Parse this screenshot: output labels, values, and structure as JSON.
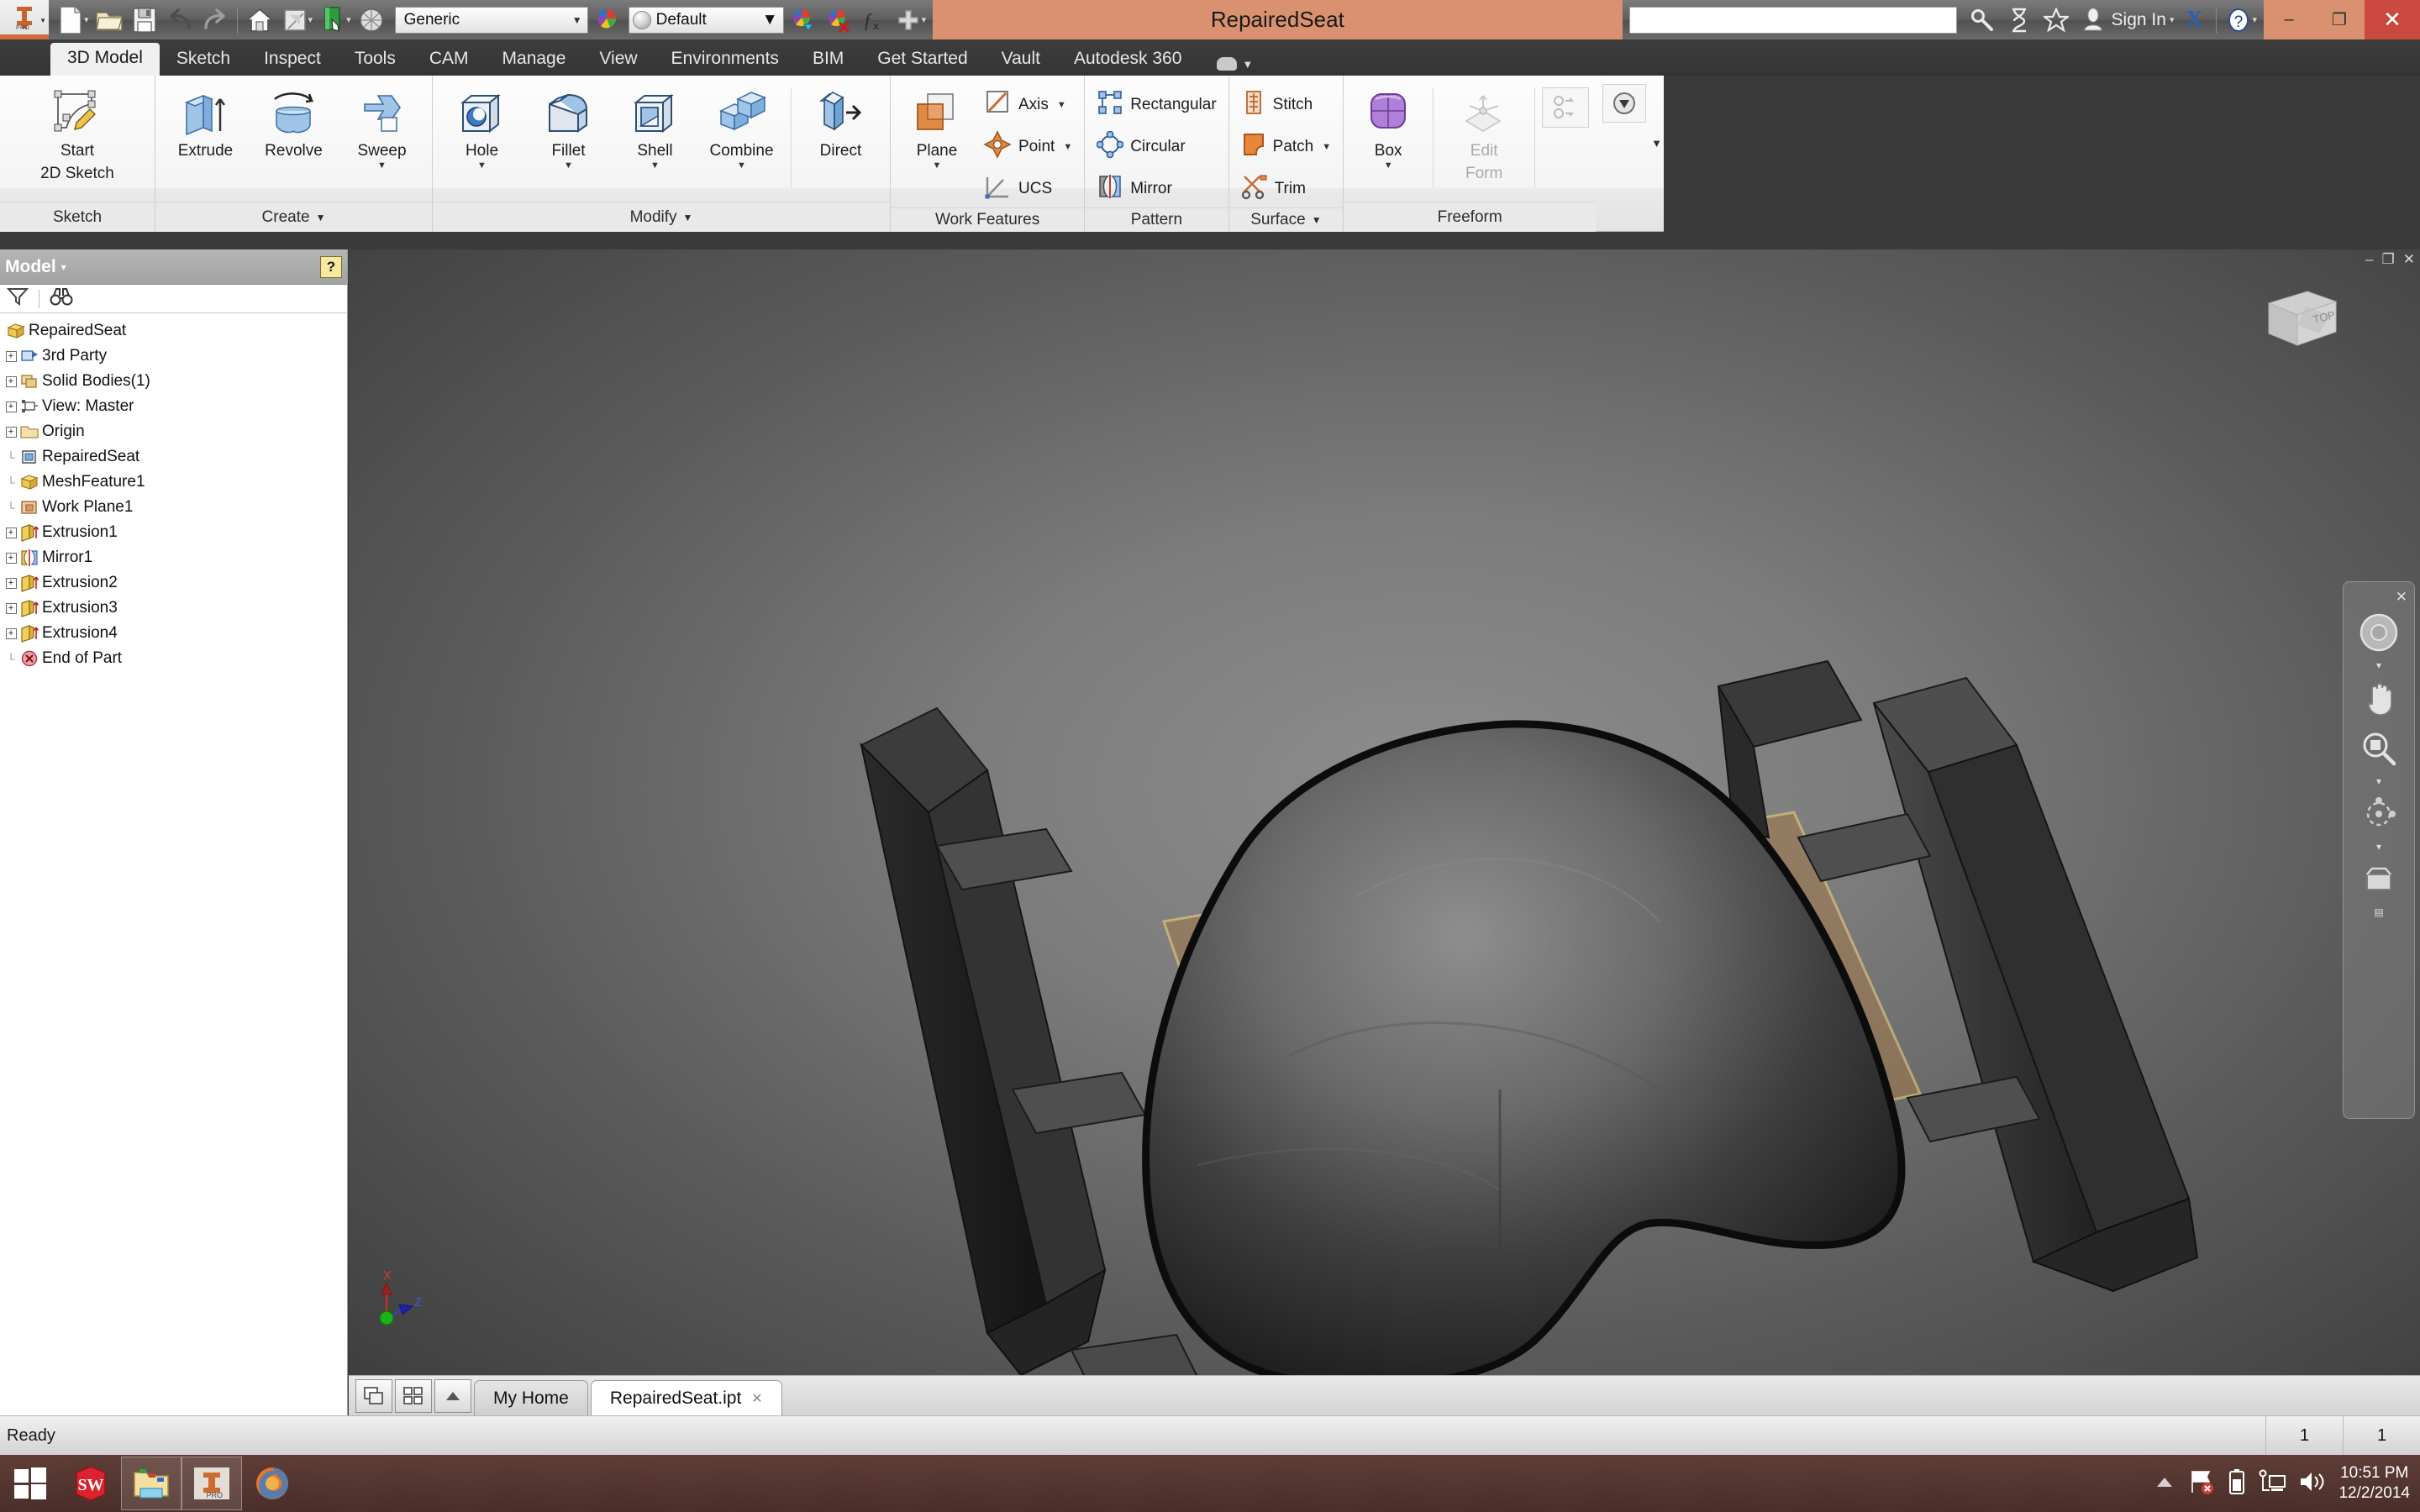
{
  "titlebar": {
    "app_icon": "inventor-pro-icon",
    "document_title": "RepairedSeat",
    "material_value": "Generic",
    "material_placeholder": "Generic",
    "appearance_value": "Default",
    "search_value": "",
    "search_placeholder": "",
    "sign_in_label": "Sign In",
    "exchange_label": "X",
    "quick_access": [
      {
        "name": "new-file-button",
        "icon": "new-document-icon"
      },
      {
        "name": "open-file-button",
        "icon": "open-folder-icon"
      },
      {
        "name": "save-file-button",
        "icon": "save-disk-icon"
      },
      {
        "name": "undo-button",
        "icon": "undo-arrow-icon"
      },
      {
        "name": "redo-button",
        "icon": "redo-arrow-icon"
      },
      {
        "name": "home-button",
        "icon": "home-icon"
      },
      {
        "name": "return-button",
        "icon": "return-icon"
      },
      {
        "name": "update-button",
        "icon": "update-book-icon"
      },
      {
        "name": "appearance-ball-button",
        "icon": "render-ball-icon"
      }
    ],
    "right_icons": [
      {
        "name": "search-button",
        "icon": "magnifier-icon"
      },
      {
        "name": "help-search-button",
        "icon": "hourglass-icon"
      },
      {
        "name": "favorites-button",
        "icon": "star-icon"
      },
      {
        "name": "account-button",
        "icon": "person-icon"
      }
    ],
    "window_controls": {
      "minimize": "–",
      "restore": "❐",
      "close": "✕"
    }
  },
  "ribbon": {
    "tabs": [
      {
        "label": "3D Model",
        "active": true
      },
      {
        "label": "Sketch",
        "active": false
      },
      {
        "label": "Inspect",
        "active": false
      },
      {
        "label": "Tools",
        "active": false
      },
      {
        "label": "CAM",
        "active": false
      },
      {
        "label": "Manage",
        "active": false
      },
      {
        "label": "View",
        "active": false
      },
      {
        "label": "Environments",
        "active": false
      },
      {
        "label": "BIM",
        "active": false
      },
      {
        "label": "Get Started",
        "active": false
      },
      {
        "label": "Vault",
        "active": false
      },
      {
        "label": "Autodesk 360",
        "active": false
      }
    ],
    "panels": [
      {
        "title": "Sketch",
        "has_dropdown": false,
        "buttons": [
          {
            "label": "Start\n2D Sketch",
            "line1": "Start",
            "line2": "2D Sketch",
            "icon": "start-2d-sketch-icon",
            "dropdown": true
          }
        ]
      },
      {
        "title": "Create",
        "has_dropdown": true,
        "buttons": [
          {
            "line1": "Extrude",
            "line2": "",
            "icon": "extrude-icon",
            "dropdown": false
          },
          {
            "line1": "Revolve",
            "line2": "",
            "icon": "revolve-icon",
            "dropdown": false
          },
          {
            "line1": "Sweep",
            "line2": "",
            "icon": "sweep-icon",
            "dropdown": true
          }
        ]
      },
      {
        "title": "Modify",
        "has_dropdown": true,
        "buttons": [
          {
            "line1": "Hole",
            "line2": "",
            "icon": "hole-icon",
            "dropdown": true
          },
          {
            "line1": "Fillet",
            "line2": "",
            "icon": "fillet-icon",
            "dropdown": true
          },
          {
            "line1": "Shell",
            "line2": "",
            "icon": "shell-icon",
            "dropdown": true
          },
          {
            "line1": "Combine",
            "line2": "",
            "icon": "combine-icon",
            "dropdown": true
          },
          {
            "line1": "Direct",
            "line2": "",
            "icon": "direct-edit-icon",
            "dropdown": false
          }
        ]
      },
      {
        "title": "Work Features",
        "has_dropdown": false,
        "buttons": [
          {
            "line1": "Plane",
            "line2": "",
            "icon": "work-plane-icon",
            "dropdown": true
          }
        ],
        "small_buttons": [
          {
            "label": "Axis",
            "icon": "work-axis-icon",
            "dropdown": true
          },
          {
            "label": "Point",
            "icon": "work-point-icon",
            "dropdown": true
          },
          {
            "label": "UCS",
            "icon": "ucs-icon",
            "dropdown": false
          }
        ]
      },
      {
        "title": "Pattern",
        "has_dropdown": false,
        "small_buttons": [
          {
            "label": "Rectangular",
            "icon": "rectangular-pattern-icon",
            "dropdown": false
          },
          {
            "label": "Circular",
            "icon": "circular-pattern-icon",
            "dropdown": false
          },
          {
            "label": "Mirror",
            "icon": "mirror-icon",
            "dropdown": false
          }
        ]
      },
      {
        "title": "Surface",
        "has_dropdown": true,
        "small_buttons": [
          {
            "label": "Stitch",
            "icon": "stitch-icon",
            "dropdown": false
          },
          {
            "label": "Patch",
            "icon": "patch-icon",
            "dropdown": true
          },
          {
            "label": "Trim",
            "icon": "trim-scissors-icon",
            "dropdown": false
          }
        ]
      },
      {
        "title": "Freeform",
        "has_dropdown": false,
        "buttons": [
          {
            "line1": "Box",
            "line2": "",
            "icon": "freeform-box-icon",
            "dropdown": true
          },
          {
            "line1": "Edit",
            "line2": "Form",
            "icon": "edit-form-icon",
            "dropdown": true,
            "disabled": true
          }
        ]
      }
    ]
  },
  "browser": {
    "title": "Model",
    "help_icon": "help-question-icon",
    "toolbar": [
      {
        "name": "filter-button",
        "icon": "filter-funnel-icon"
      },
      {
        "name": "find-button",
        "icon": "binoculars-icon"
      }
    ],
    "tree": [
      {
        "label": "RepairedSeat",
        "icon": "part-cube-icon",
        "expandable": false,
        "indent": 0,
        "root": true
      },
      {
        "label": "3rd Party",
        "icon": "third-party-icon",
        "expandable": true,
        "indent": 1
      },
      {
        "label": "Solid Bodies(1)",
        "icon": "solid-bodies-icon",
        "expandable": true,
        "indent": 1
      },
      {
        "label": "View: Master",
        "icon": "view-master-icon",
        "expandable": true,
        "indent": 1
      },
      {
        "label": "Origin",
        "icon": "origin-folder-icon",
        "expandable": true,
        "indent": 1
      },
      {
        "label": "RepairedSeat",
        "icon": "mesh-part-icon",
        "expandable": false,
        "indent": 1
      },
      {
        "label": "MeshFeature1",
        "icon": "mesh-feature-icon",
        "expandable": false,
        "indent": 1
      },
      {
        "label": "Work Plane1",
        "icon": "work-plane-tree-icon",
        "expandable": false,
        "indent": 1
      },
      {
        "label": "Extrusion1",
        "icon": "extrusion-icon",
        "expandable": true,
        "indent": 1
      },
      {
        "label": "Mirror1",
        "icon": "mirror-tree-icon",
        "expandable": true,
        "indent": 1
      },
      {
        "label": "Extrusion2",
        "icon": "extrusion-icon",
        "expandable": true,
        "indent": 1
      },
      {
        "label": "Extrusion3",
        "icon": "extrusion-icon",
        "expandable": true,
        "indent": 1
      },
      {
        "label": "Extrusion4",
        "icon": "extrusion-icon",
        "expandable": true,
        "indent": 1
      },
      {
        "label": "End of Part",
        "icon": "end-of-part-icon",
        "expandable": false,
        "indent": 1
      }
    ]
  },
  "viewport": {
    "viewcube_face": "TOP",
    "axis_x_label": "X",
    "axis_z_label": "Z",
    "window_controls": {
      "minimize": "–",
      "restore": "❐",
      "close": "✕"
    },
    "nav_close": "✕",
    "nav_items": [
      {
        "name": "full-navigation-wheel-button",
        "icon": "steering-wheel-icon"
      },
      {
        "name": "pan-button",
        "icon": "pan-hand-icon"
      },
      {
        "name": "zoom-button",
        "icon": "zoom-magnifier-icon"
      },
      {
        "name": "orbit-button",
        "icon": "orbit-icon"
      },
      {
        "name": "look-at-button",
        "icon": "look-at-icon"
      }
    ]
  },
  "doctabs": {
    "buttons": [
      {
        "name": "cascade-windows-button",
        "icon": "cascade-windows-icon"
      },
      {
        "name": "tile-windows-button",
        "icon": "tile-windows-icon"
      },
      {
        "name": "scroll-tabs-button",
        "icon": "scroll-up-icon"
      }
    ],
    "tabs": [
      {
        "label": "My Home",
        "active": false,
        "closable": false
      },
      {
        "label": "RepairedSeat.ipt",
        "active": true,
        "closable": true,
        "close_glyph": "✕"
      }
    ]
  },
  "statusbar": {
    "message": "Ready",
    "cell_1": "1",
    "cell_2": "1"
  },
  "taskbar": {
    "items": [
      {
        "name": "start-button",
        "icon": "windows-start-icon",
        "framed": false
      },
      {
        "name": "solidworks-taskbar-button",
        "icon": "solidworks-icon",
        "framed": false
      },
      {
        "name": "file-explorer-taskbar-button",
        "icon": "file-explorer-icon",
        "framed": true
      },
      {
        "name": "inventor-taskbar-button",
        "icon": "inventor-pro-icon",
        "framed": true
      },
      {
        "name": "firefox-taskbar-button",
        "icon": "firefox-icon",
        "framed": false
      }
    ],
    "tray": [
      {
        "name": "show-hidden-icons-button",
        "icon": "chevron-up-icon"
      },
      {
        "name": "action-center-button",
        "icon": "flag-error-icon"
      },
      {
        "name": "battery-button",
        "icon": "battery-icon"
      },
      {
        "name": "network-button",
        "icon": "network-icon"
      },
      {
        "name": "volume-button",
        "icon": "speaker-icon"
      }
    ],
    "clock_time": "10:51 PM",
    "clock_date": "12/2/2014"
  },
  "colors": {
    "accent_orange": "#d2693f",
    "title_bar_orange": "#da9170",
    "close_red": "#c9493f",
    "ribbon_bg": "#f4f4f4",
    "viewport_bg": "#7c7c7c"
  }
}
